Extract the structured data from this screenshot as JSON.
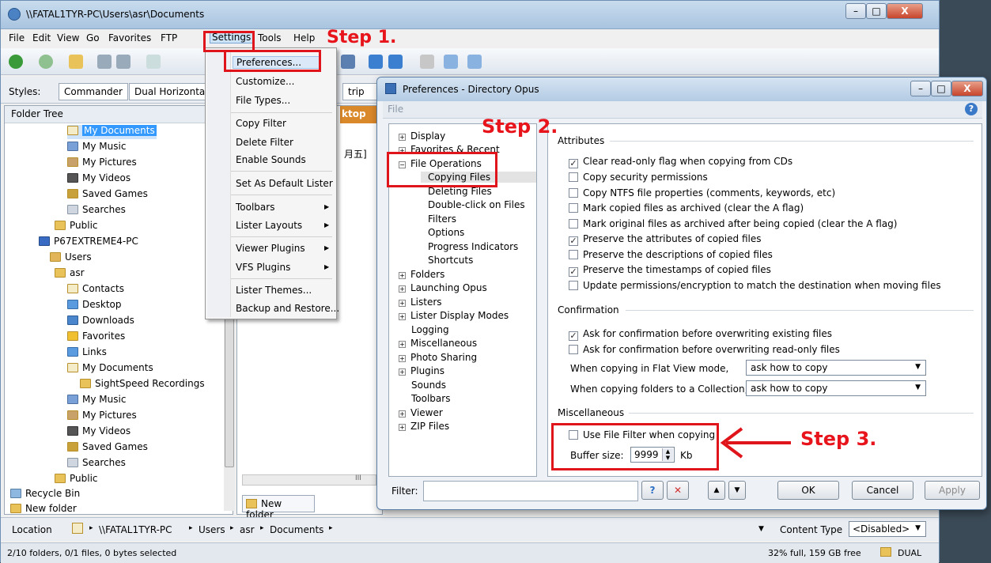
{
  "main_window": {
    "title": "\\\\FATAL1TYR-PC\\Users\\asr\\Documents",
    "controls": {
      "minimize": "–",
      "maximize": "□",
      "close": "X"
    }
  },
  "menu_bar": [
    "File",
    "Edit",
    "View",
    "Go",
    "Favorites",
    "FTP",
    "Settings",
    "Tools",
    "Help"
  ],
  "styles_bar": {
    "label": "Styles:",
    "tabs": [
      "Commander",
      "Dual Horizontal"
    ],
    "partial_tab": "trip",
    "partial_tab_2": "ktop"
  },
  "folder_tree": {
    "title": "Folder Tree",
    "items": [
      "My Documents",
      "My Music",
      "My Pictures",
      "My Videos",
      "Saved Games",
      "Searches",
      "Public",
      "P67EXTREME4-PC",
      "Users",
      "asr",
      "Contacts",
      "Desktop",
      "Downloads",
      "Favorites",
      "Links",
      "My Documents",
      "SightSpeed Recordings",
      "My Music",
      "My Pictures",
      "My Videos",
      "Saved Games",
      "Searches",
      "Public",
      "Recycle Bin",
      "New folder"
    ]
  },
  "file_pane": {
    "partial_text": "月五]",
    "new_folder": "New folder",
    "scroll_mark": "III"
  },
  "settings_menu": {
    "items": [
      "Preferences...",
      "Customize...",
      "File Types...",
      "Copy Filter",
      "Delete Filter",
      "Enable Sounds",
      "Set As Default Lister",
      "Toolbars",
      "Lister Layouts",
      "Viewer Plugins",
      "VFS Plugins",
      "Lister Themes...",
      "Backup and Restore..."
    ]
  },
  "prefs": {
    "title": "Preferences - Directory Opus",
    "header": "File",
    "help": "?",
    "tree": [
      "Display",
      "Favorites & Recent",
      "File Operations",
      "Copying Files",
      "Deleting Files",
      "Double-click on Files",
      "Filters",
      "Options",
      "Progress Indicators",
      "Shortcuts",
      "Folders",
      "Launching Opus",
      "Listers",
      "Lister Display Modes",
      "Logging",
      "Miscellaneous",
      "Photo Sharing",
      "Plugins",
      "Sounds",
      "Toolbars",
      "Viewer",
      "ZIP Files"
    ],
    "attributes": {
      "title": "Attributes",
      "options": [
        {
          "label": "Clear read-only flag when copying from CDs",
          "checked": "✓"
        },
        {
          "label": "Copy security permissions",
          "checked": ""
        },
        {
          "label": "Copy NTFS file properties (comments, keywords, etc)",
          "checked": ""
        },
        {
          "label": "Mark copied files as archived (clear the A flag)",
          "checked": ""
        },
        {
          "label": "Mark original files as archived after being copied (clear the A flag)",
          "checked": ""
        },
        {
          "label": "Preserve the attributes of copied files",
          "checked": "✓"
        },
        {
          "label": "Preserve the descriptions of copied files",
          "checked": ""
        },
        {
          "label": "Preserve the timestamps of copied files",
          "checked": "✓"
        },
        {
          "label": "Update permissions/encryption to match the destination when moving files",
          "checked": ""
        }
      ]
    },
    "confirmation": {
      "title": "Confirmation",
      "options": [
        {
          "label": "Ask for confirmation before overwriting existing files",
          "checked": "✓"
        },
        {
          "label": "Ask for confirmation before overwriting read-only files",
          "checked": ""
        }
      ],
      "flat_view_label": "When copying in Flat View mode,",
      "flat_view_value": "ask how to copy",
      "collection_label": "When copying folders to a Collection,",
      "collection_value": "ask how to copy"
    },
    "misc": {
      "title": "Miscellaneous",
      "file_filter_label": "Use File Filter when copying",
      "buffer_label": "Buffer size:",
      "buffer_value": "9999",
      "buffer_unit": "Kb"
    },
    "filter_label": "Filter:",
    "buttons": {
      "ok": "OK",
      "cancel": "Cancel",
      "apply": "Apply"
    }
  },
  "location_bar": {
    "label": "Location",
    "path": [
      "\\\\FATAL1TYR-PC",
      "Users",
      "asr",
      "Documents"
    ],
    "content_type_label": "Content Type",
    "content_type_value": "<Disabled>"
  },
  "status_bar": {
    "left": "2/10 folders, 0/1 files, 0 bytes selected",
    "right": "32% full, 159 GB free",
    "mode": "DUAL"
  },
  "annotations": {
    "step1": "Step 1.",
    "step2": "Step 2.",
    "step3": "Step 3."
  },
  "colors": {
    "annotation_red": "#e0141b",
    "selection_blue": "#3399ff"
  }
}
